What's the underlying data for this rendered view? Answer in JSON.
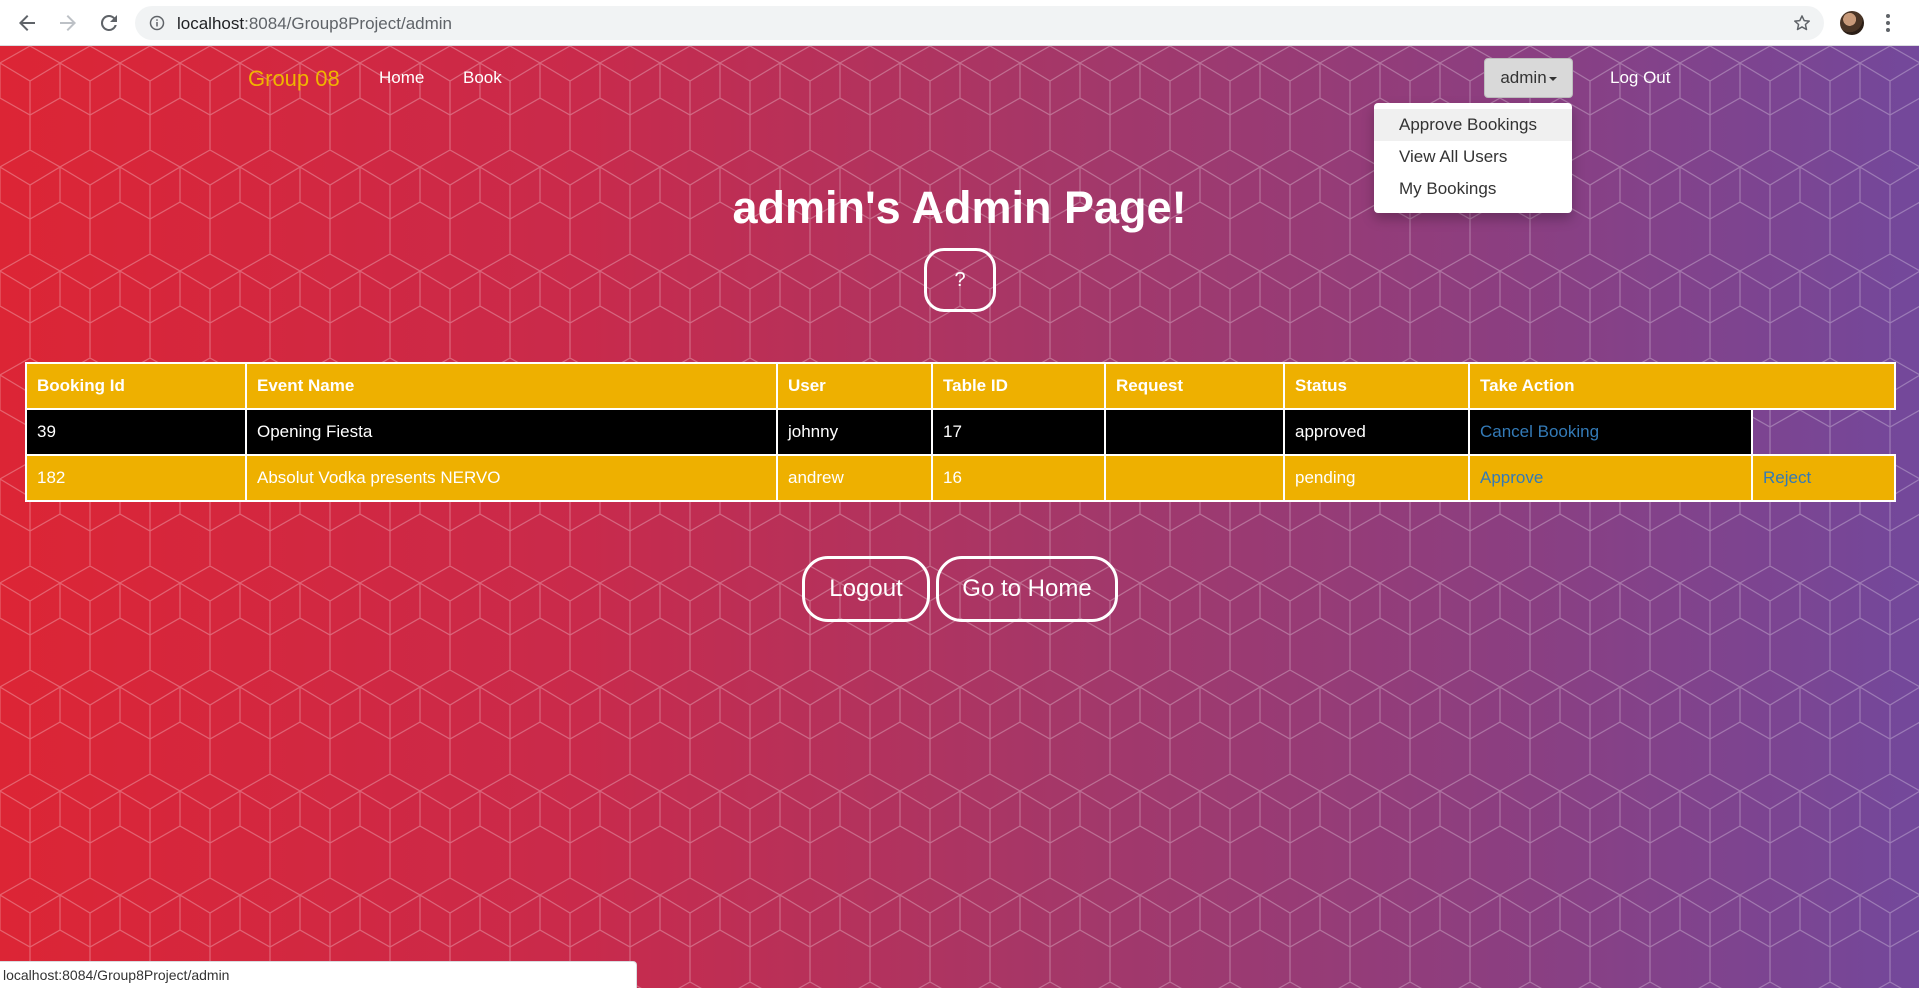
{
  "browser": {
    "url_host": "localhost",
    "url_rest": ":8084/Group8Project/admin",
    "status_url": "localhost:8084/Group8Project/admin"
  },
  "navbar": {
    "brand": "Group 08",
    "links": [
      "Home",
      "Book"
    ],
    "user_toggle": "admin",
    "logout_label": "Log Out"
  },
  "dropdown": {
    "items": [
      "Approve Bookings",
      "View All Users",
      "My Bookings"
    ]
  },
  "heading": {
    "username": "admin",
    "suffix": "'s Admin Page!"
  },
  "help_button": "?",
  "table": {
    "headers": [
      "Booking Id",
      "Event Name",
      "User",
      "Table ID",
      "Request",
      "Status",
      "Take Action"
    ],
    "rows": [
      {
        "booking_id": "39",
        "event": "Opening Fiesta",
        "user": "johnny",
        "table_id": "17",
        "request": "",
        "status": "approved",
        "action1": "Cancel Booking",
        "action2": ""
      },
      {
        "booking_id": "182",
        "event": "Absolut Vodka presents NERVO",
        "user": "andrew",
        "table_id": "16",
        "request": "",
        "status": "pending",
        "action1": "Approve",
        "action2": "Reject"
      }
    ]
  },
  "buttons": {
    "logout": "Logout",
    "home": "Go to Home"
  },
  "colors": {
    "brand": "#f0b400",
    "table_header": "#eeb000",
    "link": "#337ab7"
  }
}
